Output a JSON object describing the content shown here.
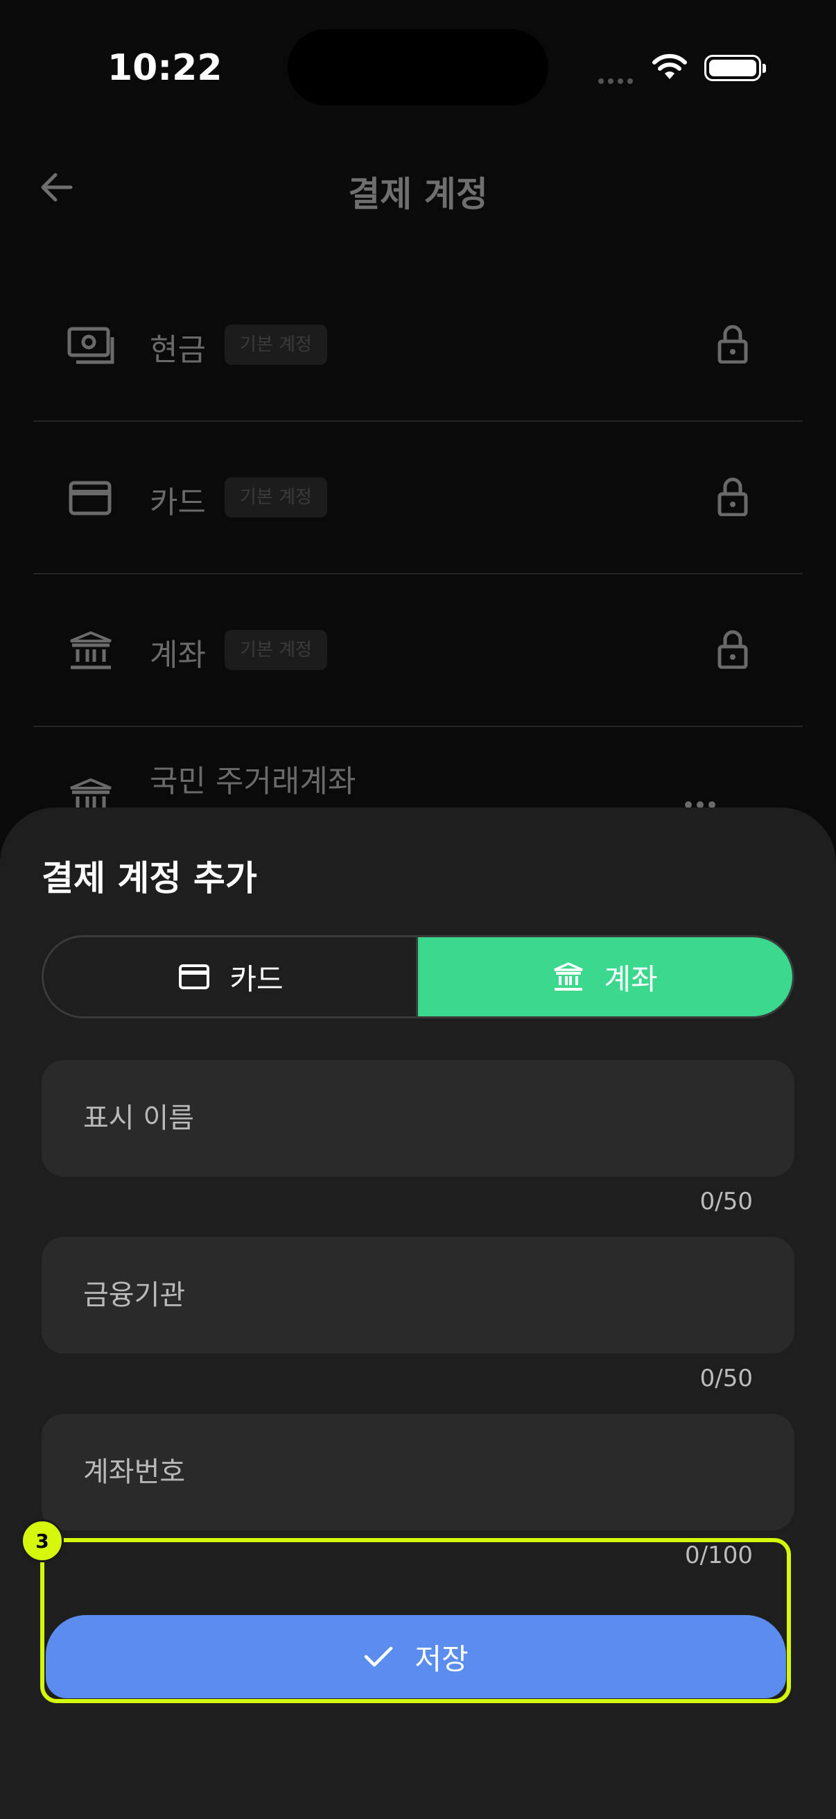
{
  "status_bar": {
    "time": "10:22"
  },
  "header": {
    "title": "결제 계정",
    "back_icon": "arrow-left-icon"
  },
  "accounts": [
    {
      "name": "현금",
      "badge": "기본 계정",
      "icon": "cash-icon",
      "locked": true
    },
    {
      "name": "카드",
      "badge": "기본 계정",
      "icon": "card-icon",
      "locked": true
    },
    {
      "name": "계좌",
      "badge": "기본 계정",
      "icon": "bank-icon",
      "locked": true
    },
    {
      "name": "국민 주거래계좌",
      "icon": "bank-icon",
      "menu_icon": "more-icon"
    }
  ],
  "sheet": {
    "title": "결제 계정 추가",
    "tabs": [
      {
        "label": "카드",
        "icon": "card-icon",
        "selected": false
      },
      {
        "label": "계좌",
        "icon": "bank-icon",
        "selected": true
      }
    ],
    "fields": [
      {
        "placeholder": "표시 이름",
        "value": "",
        "counter": "0/50"
      },
      {
        "placeholder": "금융기관",
        "value": "",
        "counter": "0/50"
      },
      {
        "placeholder": "계좌번호",
        "value": "",
        "counter": "0/100"
      }
    ],
    "save_label": "저장",
    "highlight_badge": "3"
  },
  "colors": {
    "accent_green": "#3ad98d",
    "save_blue": "#5b8def",
    "highlight": "#d4f70b"
  }
}
